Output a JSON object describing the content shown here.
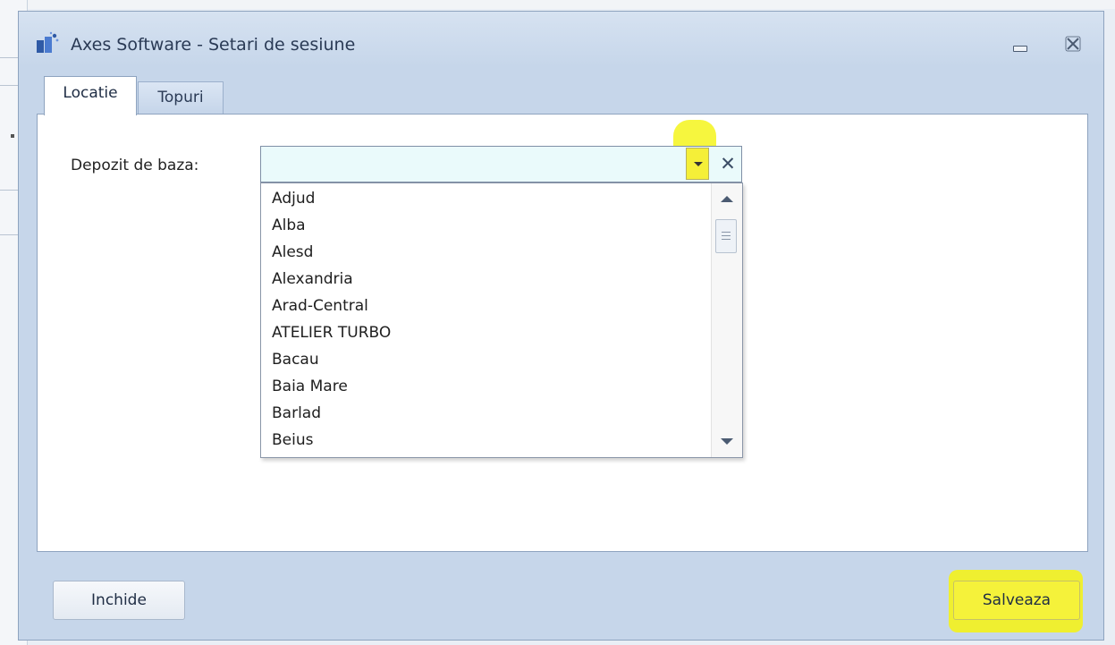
{
  "window": {
    "title": "Axes Software - Setari de sesiune",
    "icon": "axes-app-icon"
  },
  "tabs": [
    {
      "label": "Locatie",
      "active": true
    },
    {
      "label": "Topuri",
      "active": false
    }
  ],
  "form": {
    "depozit_label": "Depozit de baza:",
    "depozit_value": ""
  },
  "dropdown": {
    "items": [
      "Adjud",
      "Alba",
      "Alesd",
      "Alexandria",
      "Arad-Central",
      "ATELIER TURBO",
      "Bacau",
      "Baia Mare",
      "Barlad",
      "Beius"
    ]
  },
  "buttons": {
    "close": "Inchide",
    "save": "Salveaza"
  },
  "colors": {
    "highlight": "#f5f51c",
    "window_bg": "#c6d6ea",
    "accent": "#2a3a55"
  }
}
